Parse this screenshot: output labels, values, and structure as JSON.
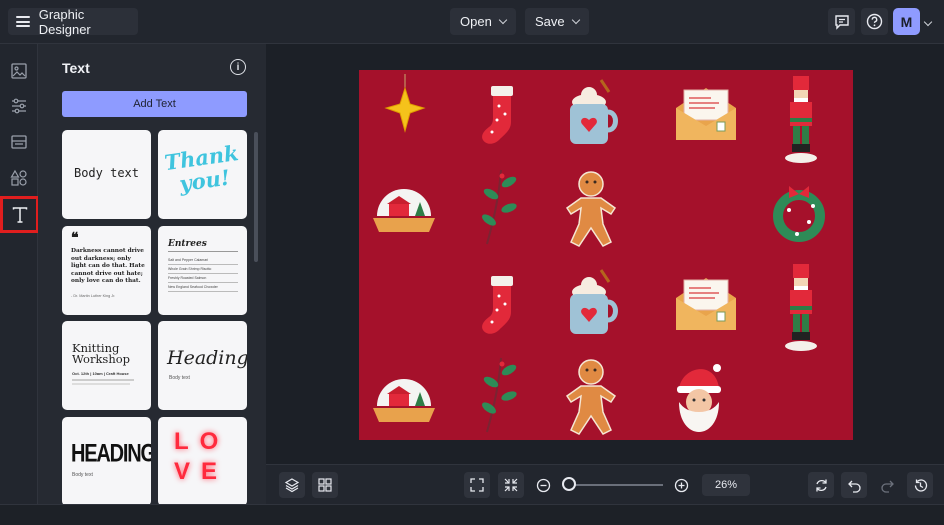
{
  "app": {
    "title": "Graphic Designer",
    "avatar_letter": "M"
  },
  "topbar": {
    "open_label": "Open",
    "save_label": "Save"
  },
  "panel": {
    "title": "Text",
    "add_text_label": "Add Text",
    "cards": {
      "body_text": "Body text",
      "thank_you": "Thank you!",
      "quote": "Darkness cannot drive out darkness; only light can do that. Hate cannot drive out hate; only love can do that.",
      "quote_author": "- Dr. Martin Luther King Jr.",
      "menu_title": "Entrees",
      "menu_items": [
        "Salt and Pepper Calamari",
        "Whole Grain Shrimp Risotto",
        "Freshly Roasted Salmon",
        "New England Seafood Chowder"
      ],
      "knitting_title": "Knitting Workshop",
      "knitting_sub": "Oct. 12th | 10am | Craft House",
      "heading_script": "Heading",
      "heading_script_sub": "Body text",
      "heading_bold": "HEADING",
      "heading_bold_sub": "Body text",
      "love": "LOVE"
    }
  },
  "zoom": {
    "value": "26%",
    "level": 0.26
  },
  "colors": {
    "accent": "#8e9bff",
    "canvas_bg": "#a5112b",
    "highlight": "#e01e1e"
  },
  "icons": {
    "rail": [
      "image-icon",
      "sliders-icon",
      "layout-icon",
      "shapes-icon",
      "text-icon"
    ],
    "topbar": [
      "menu-icon",
      "comment-icon",
      "help-icon"
    ],
    "bottombar": [
      "layers-icon",
      "grid-icon",
      "fit-screen-icon",
      "shrink-icon",
      "zoom-out-icon",
      "zoom-in-icon",
      "refresh-icon",
      "undo-icon",
      "redo-icon",
      "history-icon"
    ]
  }
}
